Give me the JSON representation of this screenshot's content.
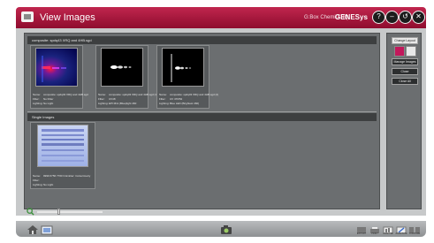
{
  "window": {
    "title": "View Images",
    "app_name": "G:Box Chemi XRQ",
    "brand": "GENESys",
    "controls": [
      "?",
      "–",
      "↺",
      "✕"
    ]
  },
  "groups": [
    {
      "heading": "composite: spdq43 XRQ and 4HB.sgd",
      "cards": [
        {
          "name_label": "Name:",
          "name": "composite: spdq43 XRQ and 4HB.sgd",
          "filter_label": "Filter:",
          "filter": "No Filter",
          "lighting_label": "Lighting:",
          "lighting": "No Light"
        },
        {
          "name_label": "Name:",
          "name": "composite: spdq43 XRQ and 4HB.sgd (1)",
          "filter_label": "Filter:",
          "filter": "UV48",
          "lighting_label": "Lighting:",
          "lighting": "EPI Mini (Blue)light 460"
        },
        {
          "name_label": "Name:",
          "name": "composite: spdq43 XRQ and 4HB.sgd (2)",
          "filter_label": "Filter:",
          "filter": "UV 470/52",
          "lighting_label": "Lighting:",
          "lighting": "Blue LED (Brightest 460)"
        }
      ]
    },
    {
      "heading": "Single Images",
      "cards": [
        {
          "name_label": "Name:",
          "name": "9999 6756 7760 3 Emitter: Colourimetry",
          "filter_label": "Filter:",
          "filter": "",
          "lighting_label": "Lighting:",
          "lighting": "No Light"
        }
      ]
    }
  ],
  "side_panel": {
    "change_layout": "Change Layout",
    "manage_images": "Manage Images",
    "close": "Close",
    "close_all": "Close All"
  },
  "bottom_bar": {
    "icons": [
      {
        "icon": "home-icon",
        "label": ""
      },
      {
        "icon": "images-icon",
        "label": ""
      },
      {
        "icon": "camera-icon",
        "label": ""
      },
      {
        "icon": "export-icon",
        "label": "EXPORT"
      },
      {
        "icon": "print-icon",
        "label": "PRINT"
      },
      {
        "icon": "analyse-icon",
        "label": "ANALYSE"
      },
      {
        "icon": "annotate-icon",
        "label": "ANNOTATE"
      },
      {
        "icon": "compare-icon",
        "label": "COMPARE"
      }
    ]
  },
  "colors": {
    "title_bar": "#a8163d",
    "panel": "#6b6e70",
    "frame": "#c7c9ca"
  }
}
